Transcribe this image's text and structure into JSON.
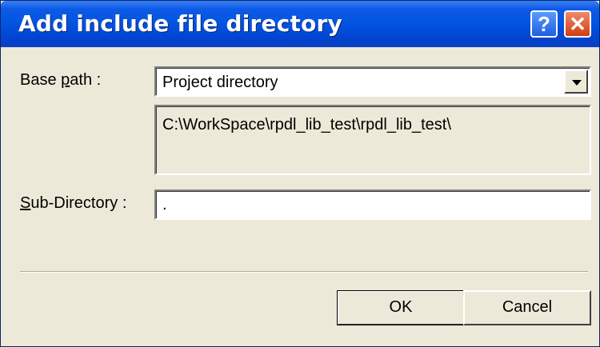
{
  "window": {
    "title": "Add include file directory",
    "help_glyph": "?",
    "close_glyph": "✕"
  },
  "base_path": {
    "label_prefix": "Base ",
    "label_underlined": "p",
    "label_suffix": "ath :",
    "selected_value": "Project directory",
    "resolved_path": "C:\\WorkSpace\\rpdl_lib_test\\rpdl_lib_test\\"
  },
  "sub_directory": {
    "label_underlined": "S",
    "label_suffix": "ub-Directory :",
    "value": "."
  },
  "buttons": {
    "ok": "OK",
    "cancel": "Cancel"
  },
  "colors": {
    "title_bar": "#0355e3",
    "dialog_face": "#ece9d8",
    "close_button": "#d23c12",
    "help_button": "#1e5fe0"
  },
  "icons": [
    "help-icon",
    "close-icon",
    "dropdown-arrow-icon"
  ]
}
